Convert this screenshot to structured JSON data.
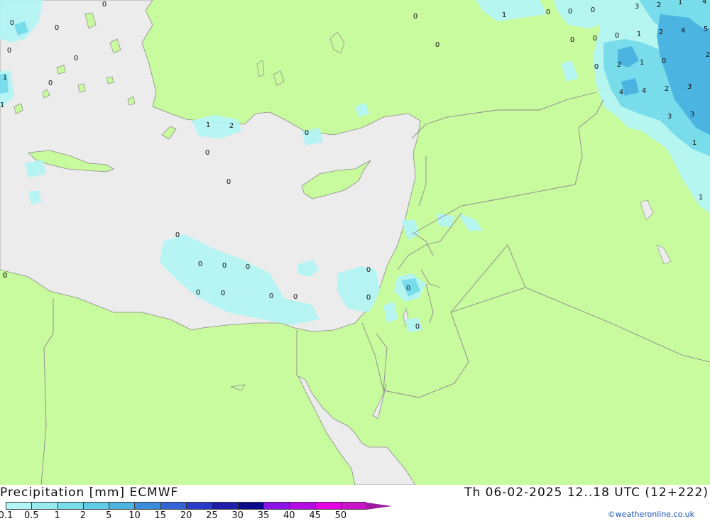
{
  "title": "Precipitation [mm] ECMWF",
  "datetime": "Th 06-02-2025 12..18 UTC (12+222)",
  "credit": "©weatheronline.co.uk",
  "legend": {
    "labels": [
      "0.1",
      "0.5",
      "1",
      "2",
      "5",
      "10",
      "15",
      "20",
      "25",
      "30",
      "35",
      "40",
      "45",
      "50"
    ],
    "colors": [
      "#b4f5f5",
      "#96eaf0",
      "#78dceb",
      "#5fcde6",
      "#4bb4e1",
      "#3c8cdc",
      "#3264d7",
      "#283cc8",
      "#1e1eaa",
      "#0a0a8c",
      "#8c14e6",
      "#b40ae6",
      "#e600e6",
      "#c814c8",
      "#9b1ba0"
    ]
  },
  "colors": {
    "land": "#c8fa9e",
    "sea": "#ececec",
    "border": "#8a8a8a",
    "light_precip": "#b4f5f5",
    "medium_precip": "#78dceb",
    "heavy_precip": "#4bb4e1"
  },
  "map_values": [
    {
      "t": "0"
    },
    {
      "t": "0"
    },
    {
      "t": "0"
    },
    {
      "t": "0"
    },
    {
      "t": "0"
    },
    {
      "t": "1"
    },
    {
      "t": "0"
    },
    {
      "t": "0"
    },
    {
      "t": "0"
    },
    {
      "t": "1"
    },
    {
      "t": "0"
    },
    {
      "t": "0"
    },
    {
      "t": "0"
    },
    {
      "t": "3"
    },
    {
      "t": "2"
    },
    {
      "t": "1"
    },
    {
      "t": "4"
    },
    {
      "t": "0"
    },
    {
      "t": "1"
    },
    {
      "t": "2"
    },
    {
      "t": "4"
    },
    {
      "t": "5"
    },
    {
      "t": "0"
    },
    {
      "t": "2"
    },
    {
      "t": "1"
    },
    {
      "t": "0"
    },
    {
      "t": "0"
    },
    {
      "t": "2"
    },
    {
      "t": "4"
    },
    {
      "t": "4"
    },
    {
      "t": "2"
    },
    {
      "t": "3"
    },
    {
      "t": "3"
    },
    {
      "t": "3"
    },
    {
      "t": "1"
    },
    {
      "t": "1"
    },
    {
      "t": "1"
    },
    {
      "t": "2"
    },
    {
      "t": "0"
    },
    {
      "t": "0"
    },
    {
      "t": "0"
    },
    {
      "t": "0"
    },
    {
      "t": "0"
    },
    {
      "t": "0"
    },
    {
      "t": "0"
    },
    {
      "t": "0"
    },
    {
      "t": "0"
    },
    {
      "t": "0"
    },
    {
      "t": "0"
    },
    {
      "t": "0"
    },
    {
      "t": "0"
    },
    {
      "t": "0"
    },
    {
      "t": "0"
    },
    {
      "t": "0"
    },
    {
      "t": "1"
    },
    {
      "t": "0"
    },
    {
      "t": "0"
    }
  ]
}
